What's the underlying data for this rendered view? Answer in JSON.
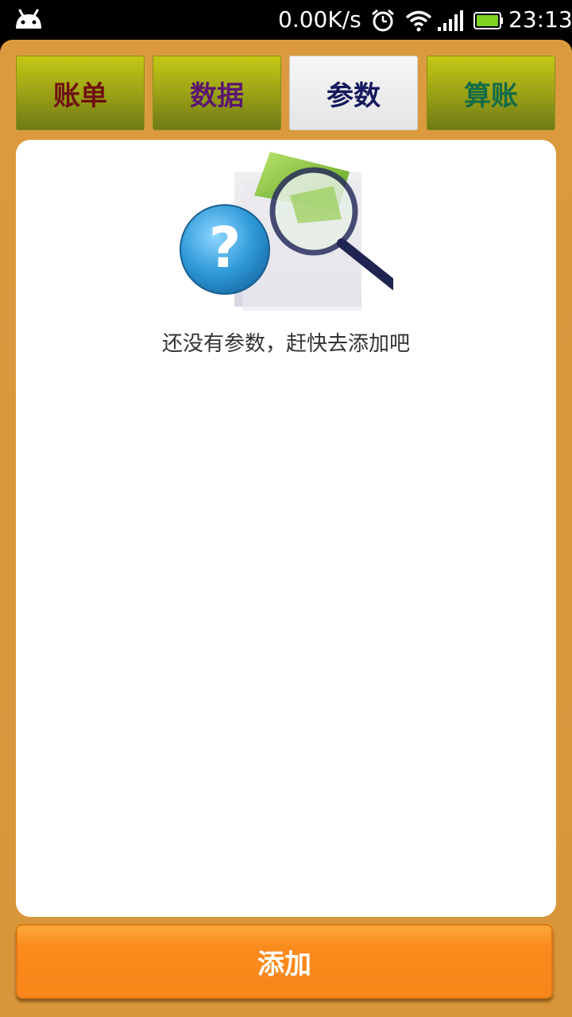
{
  "status_bar": {
    "net_speed": "0.00K/s",
    "time": "23:13",
    "icons": [
      "android-icon",
      "alarm-icon",
      "wifi-icon",
      "signal-icon",
      "battery-icon"
    ],
    "battery_color": "#7ed321"
  },
  "tabs": [
    {
      "label": "账单",
      "color": "#6e1010",
      "active": false
    },
    {
      "label": "数据",
      "color": "#5a1670",
      "active": false
    },
    {
      "label": "参数",
      "color": "#17195e",
      "active": true
    },
    {
      "label": "算账",
      "color": "#136b46",
      "active": false
    }
  ],
  "content": {
    "empty_message": "还没有参数，赶快去添加吧",
    "illustration": "search-question-icon"
  },
  "add_button": {
    "label": "添加",
    "color": "#fb8b1c"
  },
  "theme": {
    "frame_color": "#d9973e",
    "tab_gradient_top": "#c3c813",
    "tab_gradient_bottom": "#6f7a16"
  }
}
